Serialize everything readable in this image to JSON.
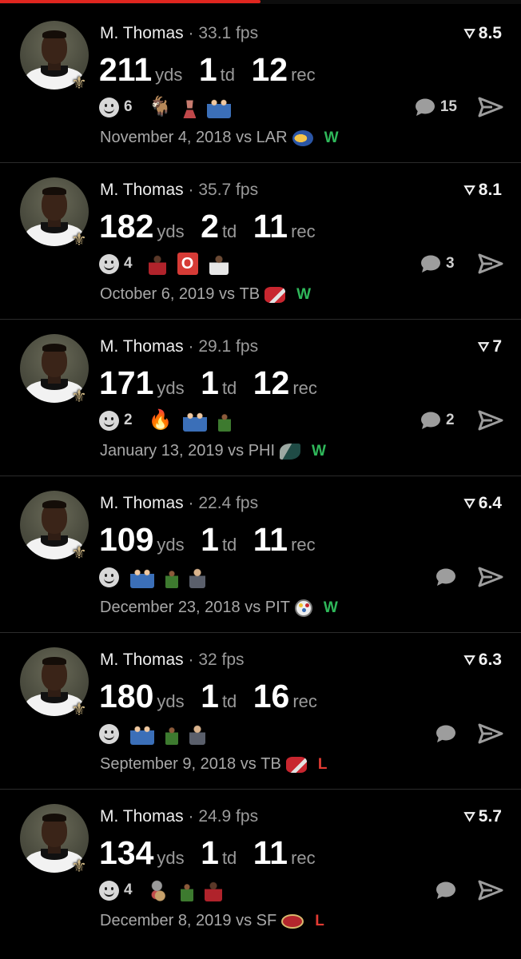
{
  "progress": {
    "fraction": 0.5,
    "color": "#e0261f"
  },
  "colors": {
    "win": "#2fb85a",
    "loss": "#e23b33",
    "background": "#000000"
  },
  "cards": [
    {
      "player": "M. Thomas",
      "sep": "·",
      "fps": "33.1 fps",
      "rating": "8.5",
      "yds": "211",
      "yds_unit": "yds",
      "td": "1",
      "td_unit": "td",
      "rec": "12",
      "rec_unit": "rec",
      "reaction_count": "6",
      "stickers": [
        "goat",
        "trophy",
        "people"
      ],
      "comments": "15",
      "date": "November 4, 2018",
      "vs": "vs",
      "opponent": "LAR",
      "opp_logo": "rams",
      "result": "W",
      "result_type": "win"
    },
    {
      "player": "M. Thomas",
      "sep": "·",
      "fps": "35.7 fps",
      "rating": "8.1",
      "yds": "182",
      "yds_unit": "yds",
      "td": "2",
      "td_unit": "td",
      "rec": "11",
      "rec_unit": "rec",
      "reaction_count": "4",
      "stickers": [
        "person-red",
        "letter-o",
        "person-white"
      ],
      "comments": "3",
      "date": "October 6, 2019",
      "vs": "vs",
      "opponent": "TB",
      "opp_logo": "bucs",
      "result": "W",
      "result_type": "win"
    },
    {
      "player": "M. Thomas",
      "sep": "·",
      "fps": "29.1 fps",
      "rating": "7",
      "yds": "171",
      "yds_unit": "yds",
      "td": "1",
      "td_unit": "td",
      "rec": "12",
      "rec_unit": "rec",
      "reaction_count": "2",
      "stickers": [
        "fire",
        "people",
        "person-green"
      ],
      "comments": "2",
      "date": "January 13, 2019",
      "vs": "vs",
      "opponent": "PHI",
      "opp_logo": "eagles",
      "result": "W",
      "result_type": "win"
    },
    {
      "player": "M. Thomas",
      "sep": "·",
      "fps": "22.4 fps",
      "rating": "6.4",
      "yds": "109",
      "yds_unit": "yds",
      "td": "1",
      "td_unit": "td",
      "rec": "11",
      "rec_unit": "rec",
      "reaction_count": "",
      "stickers": [
        "people",
        "person-green",
        "person-dark"
      ],
      "comments": "",
      "date": "December 23, 2018",
      "vs": "vs",
      "opponent": "PIT",
      "opp_logo": "steelers",
      "result": "W",
      "result_type": "win"
    },
    {
      "player": "M. Thomas",
      "sep": "·",
      "fps": "32 fps",
      "rating": "6.3",
      "yds": "180",
      "yds_unit": "yds",
      "td": "1",
      "td_unit": "td",
      "rec": "16",
      "rec_unit": "rec",
      "reaction_count": "",
      "stickers": [
        "people",
        "person-green",
        "person-dark"
      ],
      "comments": "",
      "date": "September 9, 2018",
      "vs": "vs",
      "opponent": "TB",
      "opp_logo": "bucs",
      "result": "L",
      "result_type": "loss"
    },
    {
      "player": "M. Thomas",
      "sep": "·",
      "fps": "24.9 fps",
      "rating": "5.7",
      "yds": "134",
      "yds_unit": "yds",
      "td": "1",
      "td_unit": "td",
      "rec": "11",
      "rec_unit": "rec",
      "reaction_count": "4",
      "stickers": [
        "balloon",
        "person-green",
        "person-red"
      ],
      "comments": "",
      "date": "December 8, 2019",
      "vs": "vs",
      "opponent": "SF",
      "opp_logo": "niners",
      "result": "L",
      "result_type": "loss"
    }
  ]
}
